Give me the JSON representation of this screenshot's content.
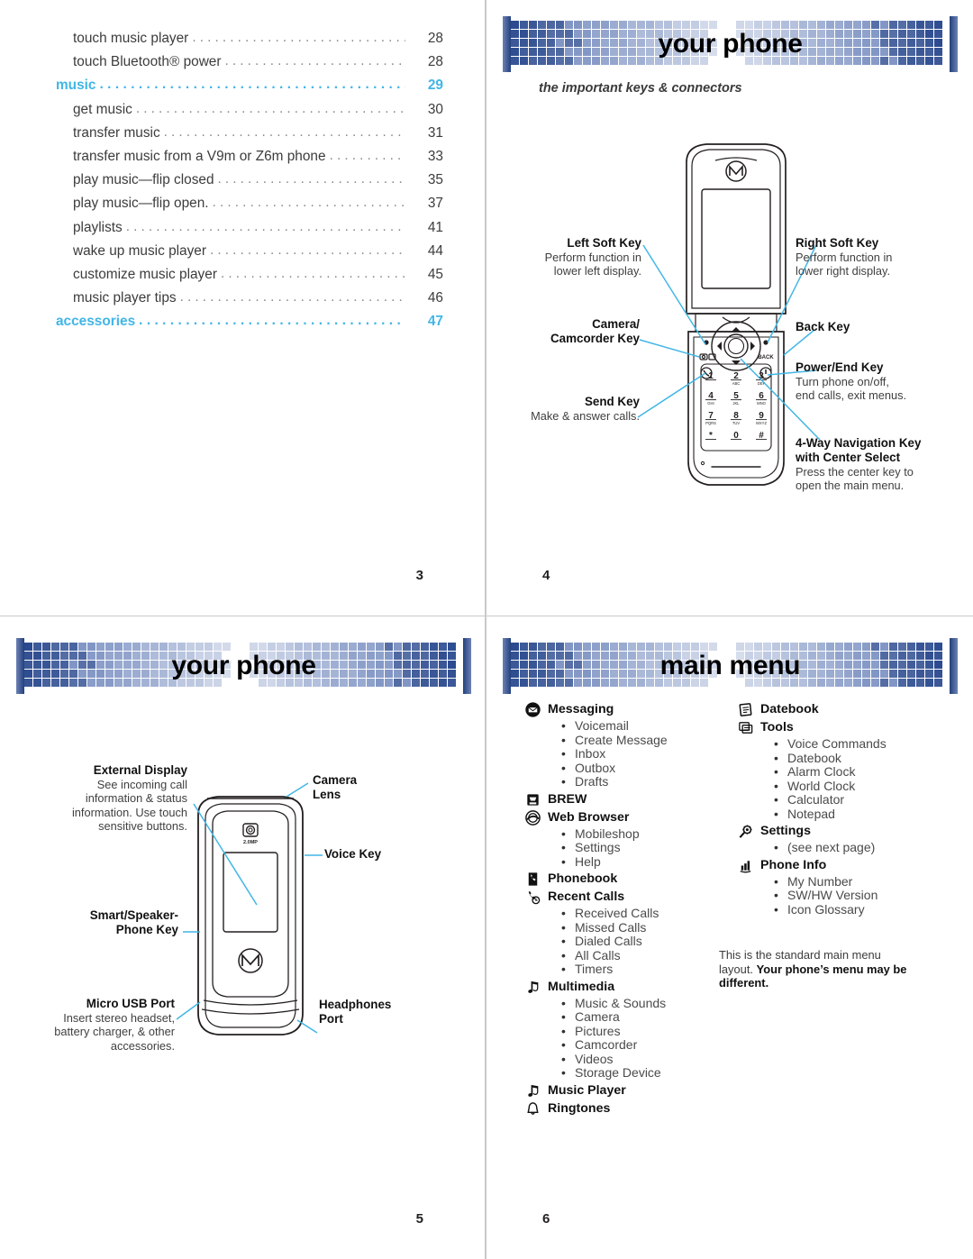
{
  "pages": {
    "p3": {
      "number": "3",
      "toc": [
        {
          "label": "touch music player",
          "page": "28",
          "level": "sub"
        },
        {
          "label": "touch Bluetooth® power",
          "page": "28",
          "level": "sub"
        },
        {
          "label": "music",
          "page": "29",
          "level": "head"
        },
        {
          "label": "get music",
          "page": "30",
          "level": "sub"
        },
        {
          "label": "transfer music",
          "page": "31",
          "level": "sub"
        },
        {
          "label": "transfer music from a V9m or Z6m phone",
          "page": "33",
          "level": "sub"
        },
        {
          "label": "play music—flip closed",
          "page": "35",
          "level": "sub"
        },
        {
          "label": "play music—flip open.",
          "page": "37",
          "level": "sub"
        },
        {
          "label": "playlists",
          "page": "41",
          "level": "sub"
        },
        {
          "label": "wake up music player",
          "page": "44",
          "level": "sub"
        },
        {
          "label": "customize music player",
          "page": "45",
          "level": "sub"
        },
        {
          "label": "music player tips",
          "page": "46",
          "level": "sub"
        },
        {
          "label": "accessories",
          "page": "47",
          "level": "head"
        }
      ]
    },
    "p4": {
      "number": "4",
      "title": "your phone",
      "subtitle": "the important keys & connectors",
      "callouts": [
        {
          "title": "Left Soft Key",
          "desc": "Perform function in\nlower left display."
        },
        {
          "title": "Camera/\nCamcorder Key",
          "desc": ""
        },
        {
          "title": "Send Key",
          "desc": "Make & answer calls."
        },
        {
          "title": "Right Soft Key",
          "desc": "Perform function in\nlower right display."
        },
        {
          "title": "Back Key",
          "desc": ""
        },
        {
          "title": "Power/End Key",
          "desc": "Turn phone on/off,\nend calls, exit menus."
        },
        {
          "title": "4-Way Navigation Key\nwith Center Select",
          "desc": "Press the center key to\nopen the main menu."
        }
      ],
      "keypad": [
        {
          "num": "1",
          "sub": ""
        },
        {
          "num": "2",
          "sub": "ABC"
        },
        {
          "num": "3",
          "sub": "DEF"
        },
        {
          "num": "4",
          "sub": "GHI"
        },
        {
          "num": "5",
          "sub": "JKL"
        },
        {
          "num": "6",
          "sub": "MNO"
        },
        {
          "num": "7",
          "sub": "PQRS"
        },
        {
          "num": "8",
          "sub": "TUV"
        },
        {
          "num": "9",
          "sub": "WXYZ"
        },
        {
          "num": "*",
          "sub": ""
        },
        {
          "num": "0",
          "sub": ""
        },
        {
          "num": "#",
          "sub": ""
        }
      ],
      "back_key_label": "BACK"
    },
    "p5": {
      "number": "5",
      "title": "your phone",
      "callouts": [
        {
          "title": "External Display",
          "desc": "See incoming call\ninformation & status\ninformation. Use touch\nsensitive buttons."
        },
        {
          "title": "Smart/Speaker-\nPhone Key",
          "desc": ""
        },
        {
          "title": "Micro USB Port",
          "desc": "Insert stereo headset,\nbattery charger, & other\naccessories."
        },
        {
          "title": "Camera\nLens",
          "desc": ""
        },
        {
          "title": "Voice Key",
          "desc": ""
        },
        {
          "title": "Headphones\nPort",
          "desc": ""
        }
      ],
      "camera_label": "2.0MP"
    },
    "p6": {
      "number": "6",
      "title": "main menu",
      "note_plain": "This is the standard main menu layout.",
      "note_bold": "Your phone’s menu may be different.",
      "left_column": [
        {
          "icon": "envelope-icon",
          "label": "Messaging",
          "subs": [
            "Voicemail",
            "Create Message",
            "Inbox",
            "Outbox",
            "Drafts"
          ]
        },
        {
          "icon": "brew-icon",
          "label": "BREW",
          "subs": []
        },
        {
          "icon": "globe-icon",
          "label": "Web Browser",
          "subs": [
            "Mobileshop",
            "Settings",
            "Help"
          ]
        },
        {
          "icon": "phonebook-icon",
          "label": "Phonebook",
          "subs": []
        },
        {
          "icon": "recent-calls-icon",
          "label": "Recent Calls",
          "subs": [
            "Received Calls",
            "Missed Calls",
            "Dialed Calls",
            "All Calls",
            "Timers"
          ]
        },
        {
          "icon": "multimedia-icon",
          "label": "Multimedia",
          "subs": [
            "Music & Sounds",
            "Camera",
            "Pictures",
            "Camcorder",
            "Videos",
            "Storage Device"
          ]
        },
        {
          "icon": "music-player-icon",
          "label": "Music Player",
          "subs": []
        },
        {
          "icon": "bell-icon",
          "label": "Ringtones",
          "subs": []
        }
      ],
      "right_column": [
        {
          "icon": "calendar-icon",
          "label": "Datebook",
          "subs": []
        },
        {
          "icon": "tools-icon",
          "label": "Tools",
          "subs": [
            "Voice Commands",
            "Datebook",
            "Alarm Clock",
            "World Clock",
            "Calculator",
            "Notepad"
          ]
        },
        {
          "icon": "gear-icon",
          "label": "Settings",
          "subs": [
            "(see next page)"
          ]
        },
        {
          "icon": "phone-info-icon",
          "label": "Phone Info",
          "subs": [
            "My Number",
            "SW/HW Version",
            "Icon Glossary"
          ]
        }
      ]
    }
  },
  "colors": {
    "accent_cyan": "#41b6e6",
    "banner_dark_blue": "#23407e",
    "banner_mid_blue": "#4a66a8",
    "leader_line": "#41b6e6",
    "text_dark": "#231f20",
    "divider": "#c9c9c9"
  }
}
